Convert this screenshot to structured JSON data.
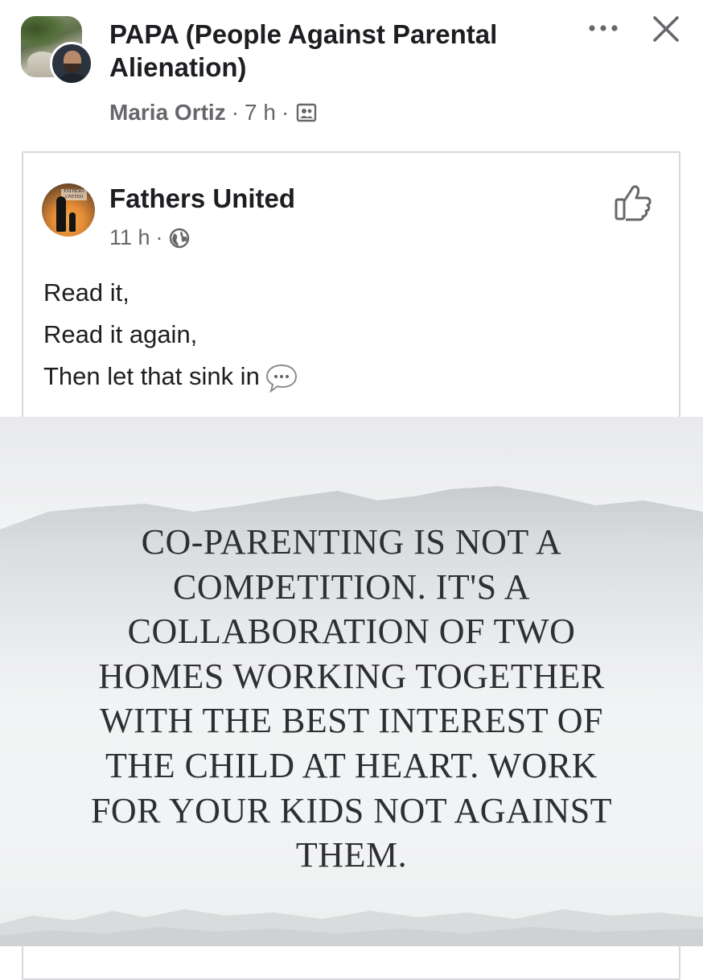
{
  "header": {
    "group_name": "PAPA (People Against Parental Alienation)",
    "author": "Maria Ortiz",
    "separator": "·",
    "time": "7 h",
    "audience_icon": "members-icon",
    "more_icon": "more-horizontal-icon",
    "close_icon": "close-icon"
  },
  "shared_post": {
    "page_name": "Fathers United",
    "avatar_badge": "FATHERS UNITED",
    "time": "11 h",
    "separator": "·",
    "audience_icon": "globe-icon",
    "like_icon": "like-icon",
    "caption": {
      "line1": "Read it,",
      "line2": "Read it again,",
      "line3": "Then let that sink in",
      "emoji": "speech-balloon-icon"
    },
    "image_text": "CO-PARENTING IS NOT A\nCOMPETITION. IT'S A\nCOLLABORATION OF TWO\nHOMES WORKING TOGETHER\nWITH THE BEST INTEREST OF\nTHE CHILD AT HEART. WORK\nFOR YOUR KIDS NOT AGAINST\nTHEM."
  },
  "colors": {
    "primary_text": "#1c1e21",
    "secondary_text": "#65676b",
    "card_border": "#d6d8dc",
    "quote_text": "#2e2f31"
  }
}
